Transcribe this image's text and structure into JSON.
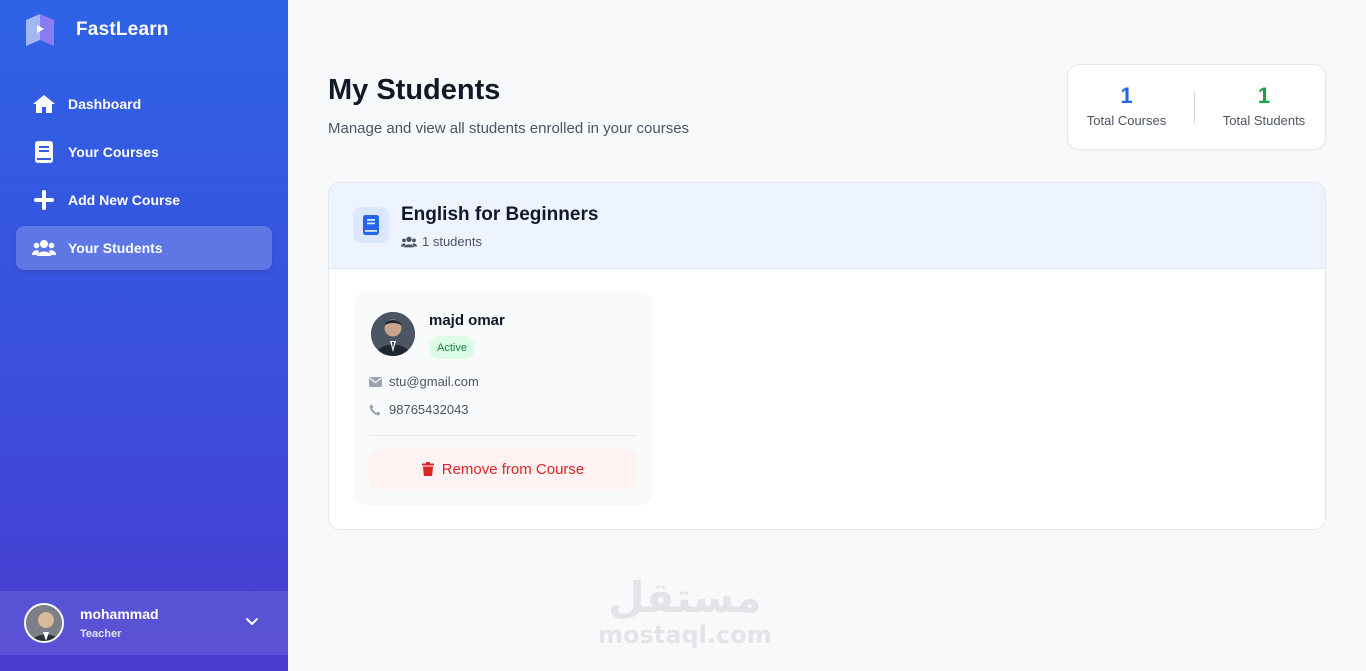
{
  "app": {
    "name": "FastLearn"
  },
  "sidebar": {
    "items": [
      {
        "label": "Dashboard",
        "icon": "home-icon",
        "active": false
      },
      {
        "label": "Your Courses",
        "icon": "book-icon",
        "active": false
      },
      {
        "label": "Add New Course",
        "icon": "plus-icon",
        "active": false
      },
      {
        "label": "Your Students",
        "icon": "users-icon",
        "active": true
      }
    ],
    "profile": {
      "name": "mohammad",
      "role": "Teacher"
    }
  },
  "header": {
    "title": "My Students",
    "subtitle": "Manage and view all students enrolled in your courses"
  },
  "stats": {
    "courses": {
      "value": "1",
      "label": "Total Courses",
      "color": "#2563eb"
    },
    "students": {
      "value": "1",
      "label": "Total Students",
      "color": "#16a34a"
    }
  },
  "course": {
    "title": "English for Beginners",
    "count_label": "1 students",
    "students": [
      {
        "name": "majd omar",
        "status": "Active",
        "email": "stu@gmail.com",
        "phone": "98765432043",
        "remove_label": "Remove from Course"
      }
    ]
  },
  "watermark": {
    "arabic": "مستقل",
    "latin": "mostaql.com"
  },
  "colors": {
    "sidebar_top": "#2f63e6",
    "sidebar_bottom": "#4a3ccf",
    "danger": "#dc2626",
    "success": "#15803d"
  }
}
